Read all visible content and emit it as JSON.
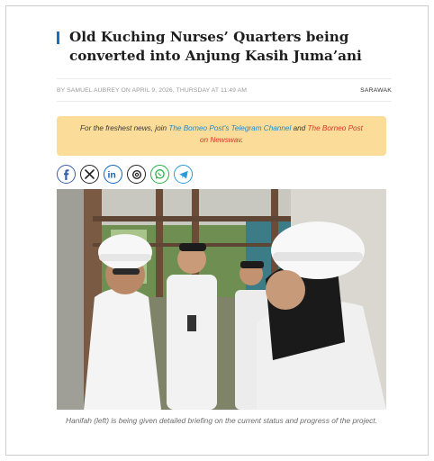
{
  "article": {
    "headline": "Old Kuching Nurses’ Quarters being converted into Anjung Kasih Juma’ani",
    "byline": "BY SAMUEL AUBREY ON APRIL 9, 2026, THURSDAY AT 11:49 AM",
    "category": "SARAWAK",
    "notice": {
      "prefix": "For the freshest news, join ",
      "telegram_link": "The Borneo Post's Telegram Channel",
      "middle": " and ",
      "newswav_link": "The Borneo Post on Newswav",
      "suffix": "."
    },
    "share_icons": [
      "facebook-icon",
      "x-icon",
      "linkedin-icon",
      "threads-icon",
      "whatsapp-icon",
      "telegram-icon"
    ],
    "photo_caption": "Hanifah (left) is being given detailed briefing on the current status and progress of the project."
  },
  "colors": {
    "accent_bar": "#1570c0",
    "notice_bg": "#fbdc98",
    "telegram_link": "#1d8ad0",
    "newswav_link": "#d8352a"
  }
}
